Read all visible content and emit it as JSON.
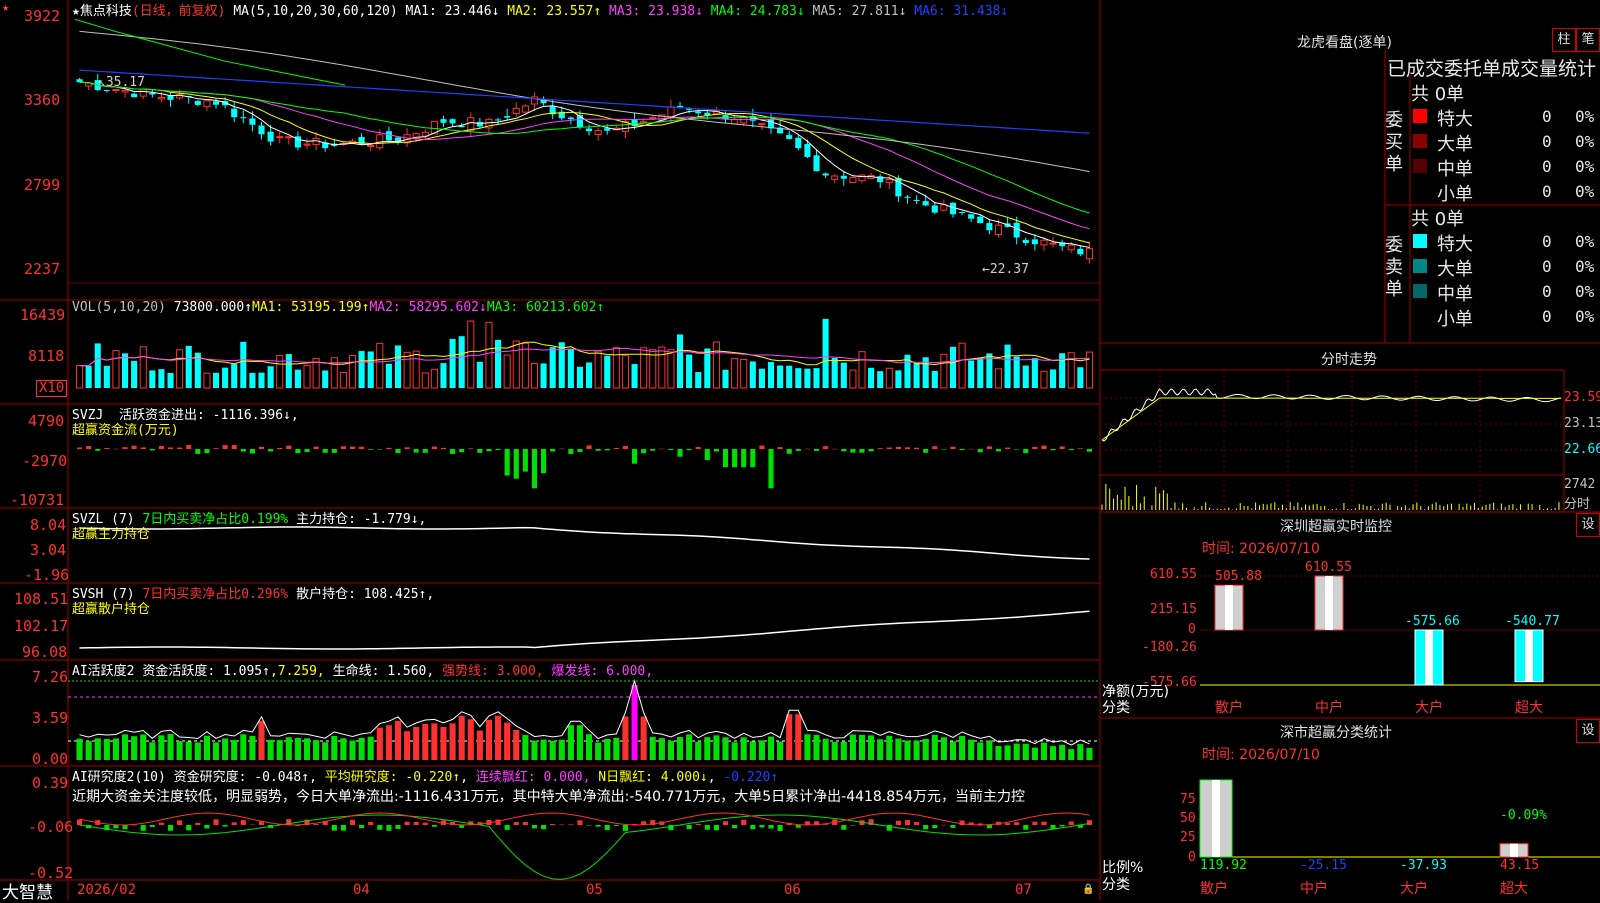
{
  "app": {
    "logo": "大智慧",
    "window_mark": "★"
  },
  "stock": {
    "name": "焦点科技",
    "period": "(日线，前复权)"
  },
  "ma_header": {
    "label": "MA(5,10,20,30,60,120)",
    "items": [
      {
        "t": "MA1: 23.446↓",
        "c": "#ffffff"
      },
      {
        "t": "MA2: 23.557↑",
        "c": "#ffff00"
      },
      {
        "t": "MA3: 23.938↓",
        "c": "#ff40ff"
      },
      {
        "t": "MA4: 24.783↓",
        "c": "#00ff00"
      },
      {
        "t": "MA5: 27.811↓",
        "c": "#c0c0c0"
      },
      {
        "t": "MA6: 31.438↓",
        "c": "#2040ff"
      }
    ]
  },
  "price_axis": [
    "3922",
    "3360",
    "2799",
    "2237"
  ],
  "price_labels": {
    "high": "35.17",
    "low": "22.37"
  },
  "vol_header": {
    "label": "VOL(5,10,20)",
    "value": "73800.000↑",
    "ma1": "MA1: 53195.199↑",
    "ma2": "MA2: 58295.602↓",
    "ma3": "MA3: 60213.602↑"
  },
  "vol_axis": [
    "16439",
    "8118"
  ],
  "vol_unit": "X10",
  "svzj": {
    "label": "SVZJ",
    "text": "活跃资金进出: -1116.396↓,",
    "subtitle": "超赢资金流(万元)",
    "axis": [
      "4790",
      "-2970",
      "-10731"
    ]
  },
  "svzl": {
    "label": "SVZL (7)",
    "ratio": "7日内买卖净占比0.199%",
    "hold": "主力持仓: -1.779↓,",
    "subtitle": "超赢主力持仓",
    "axis": [
      "8.04",
      "3.04",
      "-1.96"
    ]
  },
  "svsh": {
    "label": "SVSH (7)",
    "ratio": "7日内买卖净占比0.296%",
    "hold": "散户持仓: 108.425↑,",
    "subtitle": "超赢散户持仓",
    "axis": [
      "108.51",
      "102.17",
      "96.08"
    ]
  },
  "ai1": {
    "label": "AI活跃度2",
    "active": "资金活跃度: 1.095↑",
    "v2": "7.259,",
    "life": "生命线: 1.560,",
    "strong": "强势线: 3.000,",
    "burst": "爆发线: 6.000,",
    "axis": [
      "7.26",
      "3.59",
      "0.00"
    ]
  },
  "ai2": {
    "label": "AI研究度2(10)",
    "research": "资金研究度: -0.048↑",
    "avg": "平均研究度: -0.220↑",
    "red": "连续飘红: 0.000,",
    "nred": "N日飘红: 4.000↓",
    "v5": "-0.220↑",
    "axis": [
      "0.39",
      "-0.06",
      "-0.52"
    ],
    "comment": "近期大资金关注度较低，明显弱势，今日大单净流出:-1116.431万元，其中特大单净流出:-540.771万元，大单5日累计净出-4418.854万元，当前主力控"
  },
  "date_axis": [
    "2026/02",
    "04",
    "05",
    "06",
    "07"
  ],
  "longhu": {
    "title": "龙虎看盘(逐单)",
    "btn1": "柱",
    "btn2": "笔",
    "header": "已成交委托单成交量统计",
    "buy": {
      "side": "委买单",
      "total": "共 0单",
      "rows": [
        {
          "name": "特大",
          "count": "0",
          "pct": "0%",
          "color": "#ff0000"
        },
        {
          "name": "大单",
          "count": "0",
          "pct": "0%",
          "color": "#880000"
        },
        {
          "name": "中单",
          "count": "0",
          "pct": "0%",
          "color": "#550000"
        },
        {
          "name": "小单",
          "count": "0",
          "pct": "0%",
          "color": "#000000"
        }
      ]
    },
    "sell": {
      "side": "委卖单",
      "total": "共 0单",
      "rows": [
        {
          "name": "特大",
          "count": "0",
          "pct": "0%",
          "color": "#00ffff"
        },
        {
          "name": "大单",
          "count": "0",
          "pct": "0%",
          "color": "#008888"
        },
        {
          "name": "中单",
          "count": "0",
          "pct": "0%",
          "color": "#006666"
        },
        {
          "name": "小单",
          "count": "0",
          "pct": "0%",
          "color": "#000000"
        }
      ]
    }
  },
  "intraday": {
    "title": "分时走势",
    "axis": [
      "23.59",
      "23.13",
      "22.66"
    ],
    "vol_label": "2742",
    "vol_unit": "分时"
  },
  "sz_monitor": {
    "title": "深圳超赢实时监控",
    "btn": "设",
    "time": "时间: 2026/07/10",
    "axis": [
      "610.55",
      "215.15",
      "0",
      "-180.26",
      "-575.66"
    ],
    "ylabel": "净额(万元)",
    "xlabel": "分类",
    "cats": [
      "散户",
      "中户",
      "大户",
      "超大"
    ],
    "values": [
      505.88,
      610.55,
      -575.66,
      -540.77
    ],
    "value_labels": [
      "505.88",
      "610.55",
      "-575.66",
      "-540.77"
    ]
  },
  "sz_class": {
    "title": "深市超赢分类统计",
    "btn": "设",
    "time": "时间: 2026/07/10",
    "axis": [
      "75",
      "50",
      "25",
      "0"
    ],
    "ylabel": "比例%",
    "xlabel": "分类",
    "cats": [
      "散户",
      "中户",
      "大户",
      "超大"
    ],
    "values": [
      119.92,
      -25.15,
      -37.93,
      43.15
    ],
    "value_labels": [
      "119.92",
      "-25.15",
      "-37.93",
      "43.15"
    ],
    "top_label": "-0.09%"
  },
  "colors": {
    "up": "#ff3030",
    "down": "#00ffff",
    "grid": "#a00000",
    "green": "#00e000"
  }
}
